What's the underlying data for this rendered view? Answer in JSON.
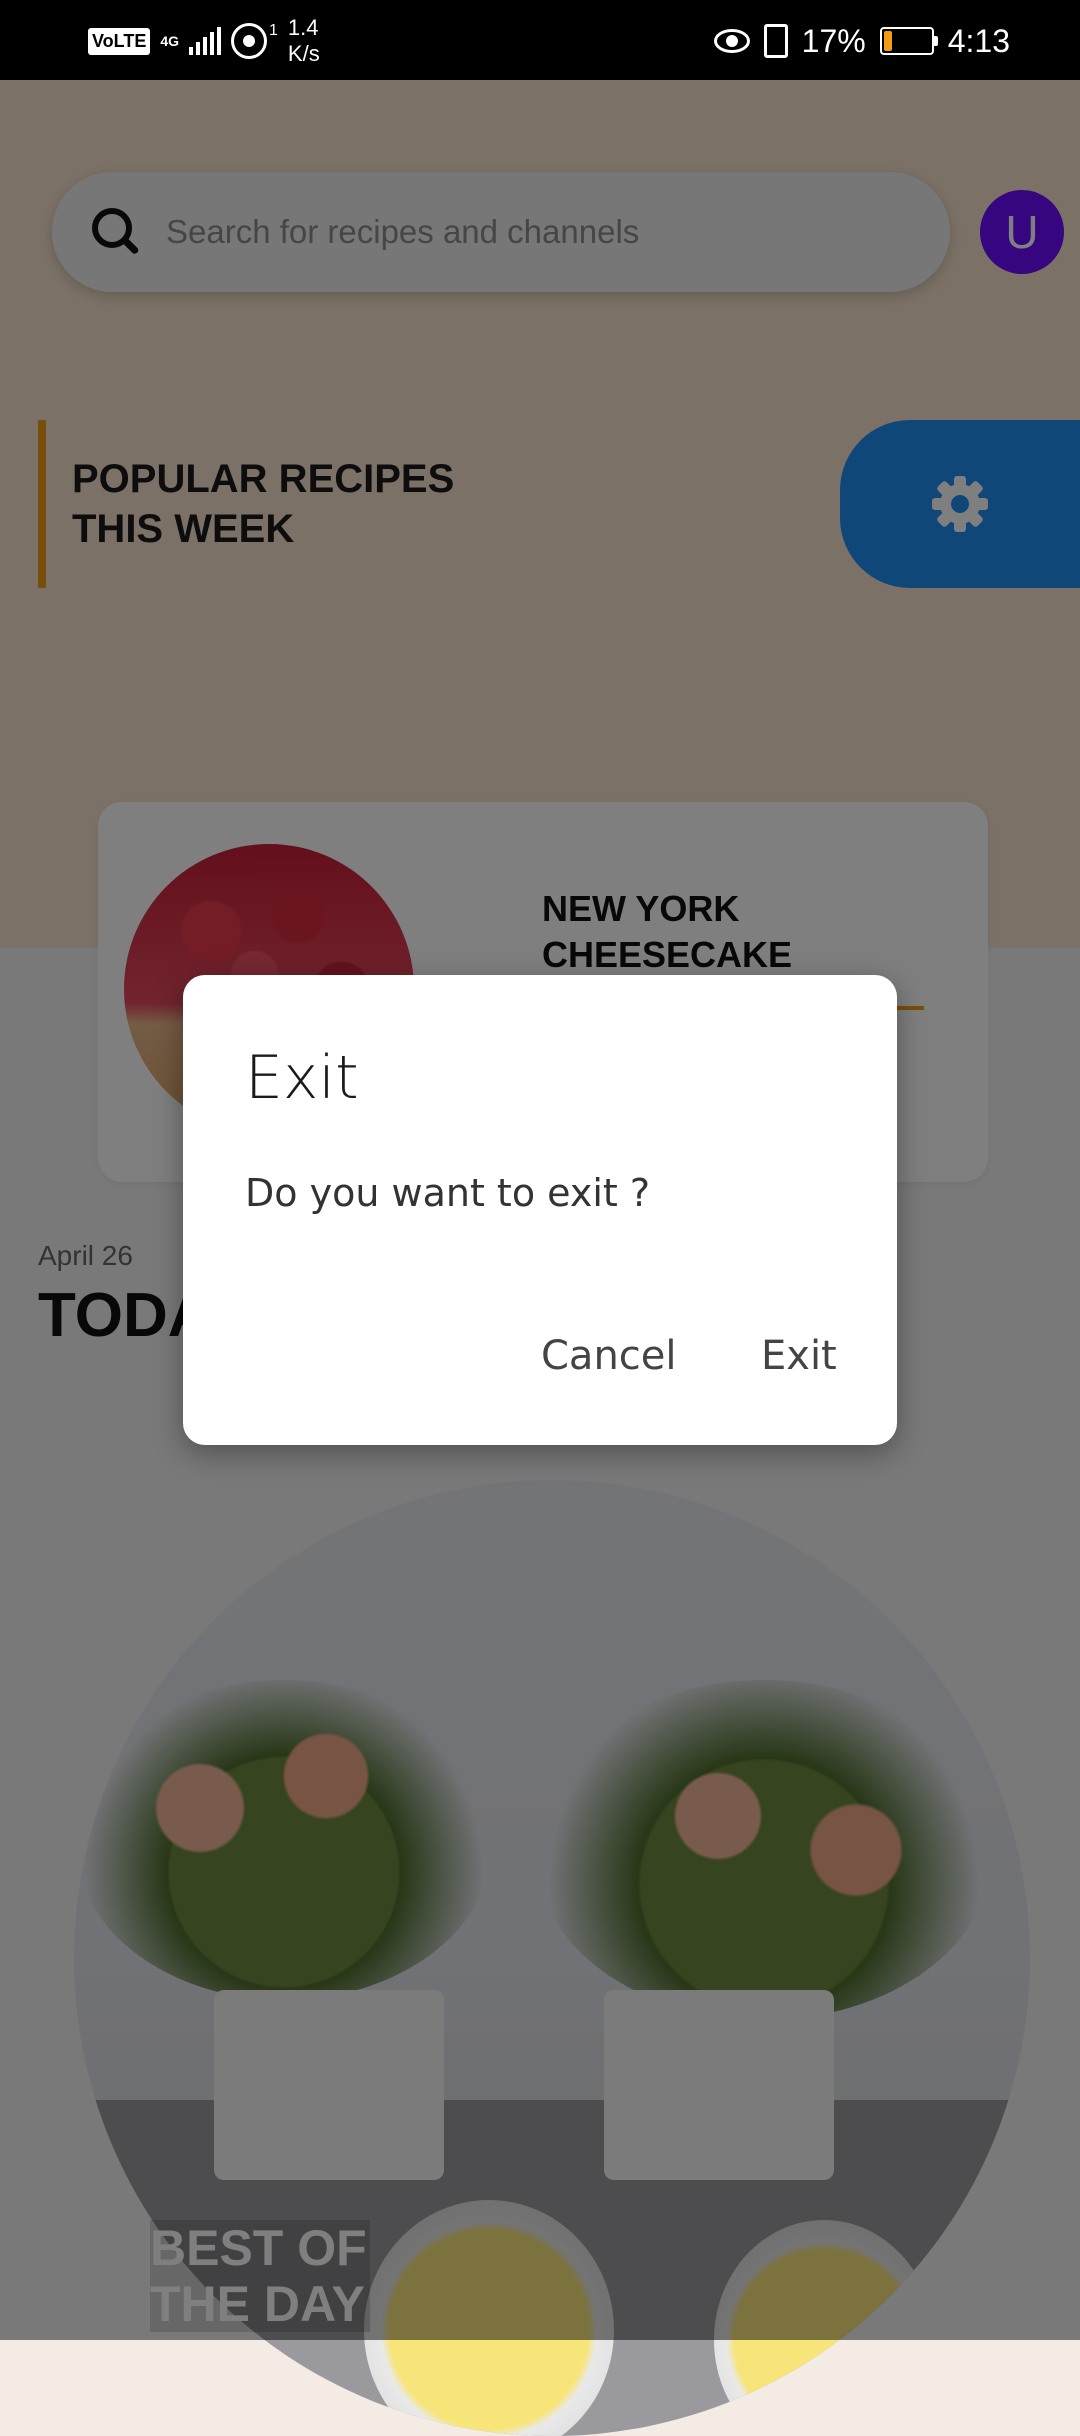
{
  "status_bar": {
    "network_badge": "VoLTE",
    "network_type": "4G",
    "hotspot_count": "1",
    "speed_value": "1.4",
    "speed_unit": "K/s",
    "battery_percent": "17%",
    "time": "4:13"
  },
  "search": {
    "placeholder": "Search for recipes and channels"
  },
  "user": {
    "avatar_letter": "U",
    "avatar_color": "#6a0dff"
  },
  "popular": {
    "title": "POPULAR RECIPES THIS WEEK",
    "accent_color": "#f29c16",
    "settings_tab_color": "#1f8ef0",
    "settings_icon": "gear-icon"
  },
  "featured_recipe": {
    "name": "NEW YORK CHEESECAKE"
  },
  "today": {
    "date": "April 26",
    "title": "TODAY"
  },
  "hero": {
    "label": "BEST OF THE DAY"
  },
  "dialog": {
    "title": "Exit",
    "message": "Do you want to exit ?",
    "cancel_label": "Cancel",
    "exit_label": "Exit"
  }
}
